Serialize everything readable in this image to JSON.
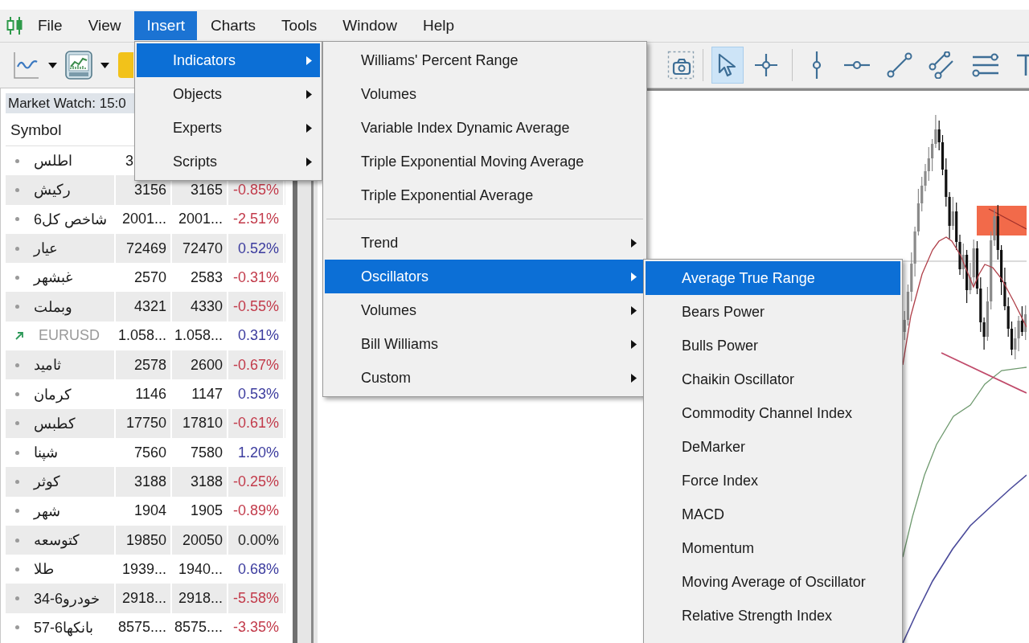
{
  "menu_bar": {
    "items": [
      {
        "label": "File",
        "selected": false
      },
      {
        "label": "View",
        "selected": false
      },
      {
        "label": "Insert",
        "selected": true
      },
      {
        "label": "Charts",
        "selected": false
      },
      {
        "label": "Tools",
        "selected": false
      },
      {
        "label": "Window",
        "selected": false
      },
      {
        "label": "Help",
        "selected": false
      }
    ]
  },
  "drawing_tools": [
    {
      "kind": "cursor",
      "selected": true
    },
    {
      "kind": "crosshair",
      "selected": false
    },
    {
      "kind": "separator"
    },
    {
      "kind": "vertical-line",
      "selected": false
    },
    {
      "kind": "horizontal-line",
      "selected": false
    },
    {
      "kind": "trend-line",
      "selected": false
    },
    {
      "kind": "channel",
      "selected": false
    },
    {
      "kind": "levels",
      "selected": false
    },
    {
      "kind": "text",
      "selected": false
    }
  ],
  "market_watch": {
    "title": "Market Watch: 15:0",
    "columns": [
      "Symbol"
    ],
    "rows": [
      {
        "kind": "stock",
        "symbol": "اطلس",
        "bid": "3"
      },
      {
        "kind": "stock",
        "symbol": "رکیش",
        "bid": "3156",
        "ask": "3165",
        "change": {
          "text": "-0.85%",
          "color": "#c23a4a"
        }
      },
      {
        "kind": "stock",
        "symbol": "شاخص کل6",
        "bid": "2001...",
        "ask": "2001...",
        "change": {
          "text": "-2.51%",
          "color": "#c23a4a"
        }
      },
      {
        "kind": "stock",
        "symbol": "عیار",
        "bid": "72469",
        "ask": "72470",
        "change": {
          "text": "0.52%",
          "color": "#3b3b9e"
        }
      },
      {
        "kind": "stock",
        "symbol": "غبشهر",
        "bid": "2570",
        "ask": "2583",
        "change": {
          "text": "-0.31%",
          "color": "#c23a4a"
        }
      },
      {
        "kind": "stock",
        "symbol": "وبملت",
        "bid": "4321",
        "ask": "4330",
        "change": {
          "text": "-0.55%",
          "color": "#c23a4a"
        }
      },
      {
        "kind": "currency",
        "symbol": "EURUSD",
        "bid": "1.058...",
        "ask": "1.058...",
        "change": {
          "text": "0.31%",
          "color": "#3b3b9e"
        }
      },
      {
        "kind": "stock",
        "symbol": "ثامید",
        "bid": "2578",
        "ask": "2600",
        "change": {
          "text": "-0.67%",
          "color": "#c23a4a"
        }
      },
      {
        "kind": "stock",
        "symbol": "کرمان",
        "bid": "1146",
        "ask": "1147",
        "change": {
          "text": "0.53%",
          "color": "#3b3b9e"
        }
      },
      {
        "kind": "stock",
        "symbol": "کطبس",
        "bid": "17750",
        "ask": "17810",
        "change": {
          "text": "-0.61%",
          "color": "#c23a4a"
        }
      },
      {
        "kind": "stock",
        "symbol": "شپنا",
        "bid": "7560",
        "ask": "7580",
        "change": {
          "text": "1.20%",
          "color": "#3b3b9e"
        }
      },
      {
        "kind": "stock",
        "symbol": "کوثر",
        "bid": "3188",
        "ask": "3188",
        "change": {
          "text": "-0.25%",
          "color": "#c23a4a"
        }
      },
      {
        "kind": "stock",
        "symbol": "شهر",
        "bid": "1904",
        "ask": "1905",
        "change": {
          "text": "-0.89%",
          "color": "#c23a4a"
        }
      },
      {
        "kind": "stock",
        "symbol": "کتوسعه",
        "bid": "19850",
        "ask": "20050",
        "change": {
          "text": "0.00%",
          "color": "#222222"
        }
      },
      {
        "kind": "stock",
        "symbol": "طلا",
        "bid": "1939...",
        "ask": "1940...",
        "change": {
          "text": "0.68%",
          "color": "#3b3b9e"
        }
      },
      {
        "kind": "stock",
        "symbol": "خودرو6-34",
        "bid": "2918...",
        "ask": "2918...",
        "change": {
          "text": "-5.58%",
          "color": "#c23a4a"
        }
      },
      {
        "kind": "stock",
        "symbol": "بانکها6-57",
        "bid": "8575....",
        "ask": "8575....",
        "change": {
          "text": "-3.35%",
          "color": "#c23a4a"
        }
      }
    ]
  },
  "insert_menu": {
    "items": [
      {
        "label": "Indicators",
        "submenu": true,
        "selected": true
      },
      {
        "label": "Objects",
        "submenu": true,
        "selected": false
      },
      {
        "label": "Experts",
        "submenu": true,
        "selected": false
      },
      {
        "label": "Scripts",
        "submenu": true,
        "selected": false
      }
    ]
  },
  "indicators_menu": {
    "items": [
      {
        "kind": "item",
        "label": "Williams' Percent Range",
        "submenu": false,
        "selected": false
      },
      {
        "kind": "item",
        "label": "Volumes",
        "submenu": false,
        "selected": false
      },
      {
        "kind": "item",
        "label": "Variable Index Dynamic Average",
        "submenu": false,
        "selected": false
      },
      {
        "kind": "item",
        "label": "Triple Exponential Moving Average",
        "submenu": false,
        "selected": false
      },
      {
        "kind": "item",
        "label": "Triple Exponential Average",
        "submenu": false,
        "selected": false
      },
      {
        "kind": "separator"
      },
      {
        "kind": "item",
        "label": "Trend",
        "submenu": true,
        "selected": false
      },
      {
        "kind": "item",
        "label": "Oscillators",
        "submenu": true,
        "selected": true
      },
      {
        "kind": "item",
        "label": "Volumes",
        "submenu": true,
        "selected": false
      },
      {
        "kind": "item",
        "label": "Bill Williams",
        "submenu": true,
        "selected": false
      },
      {
        "kind": "item",
        "label": "Custom",
        "submenu": true,
        "selected": false
      }
    ]
  },
  "oscillators_menu": {
    "items": [
      {
        "label": "Average True Range",
        "selected": true
      },
      {
        "label": "Bears Power",
        "selected": false
      },
      {
        "label": "Bulls Power",
        "selected": false
      },
      {
        "label": "Chaikin Oscillator",
        "selected": false
      },
      {
        "label": "Commodity Channel Index",
        "selected": false
      },
      {
        "label": "DeMarker",
        "selected": false
      },
      {
        "label": "Force Index",
        "selected": false
      },
      {
        "label": "MACD",
        "selected": false
      },
      {
        "label": "Momentum",
        "selected": false
      },
      {
        "label": "Moving Average of Oscillator",
        "selected": false
      },
      {
        "label": "Relative Strength Index",
        "selected": false
      }
    ]
  }
}
